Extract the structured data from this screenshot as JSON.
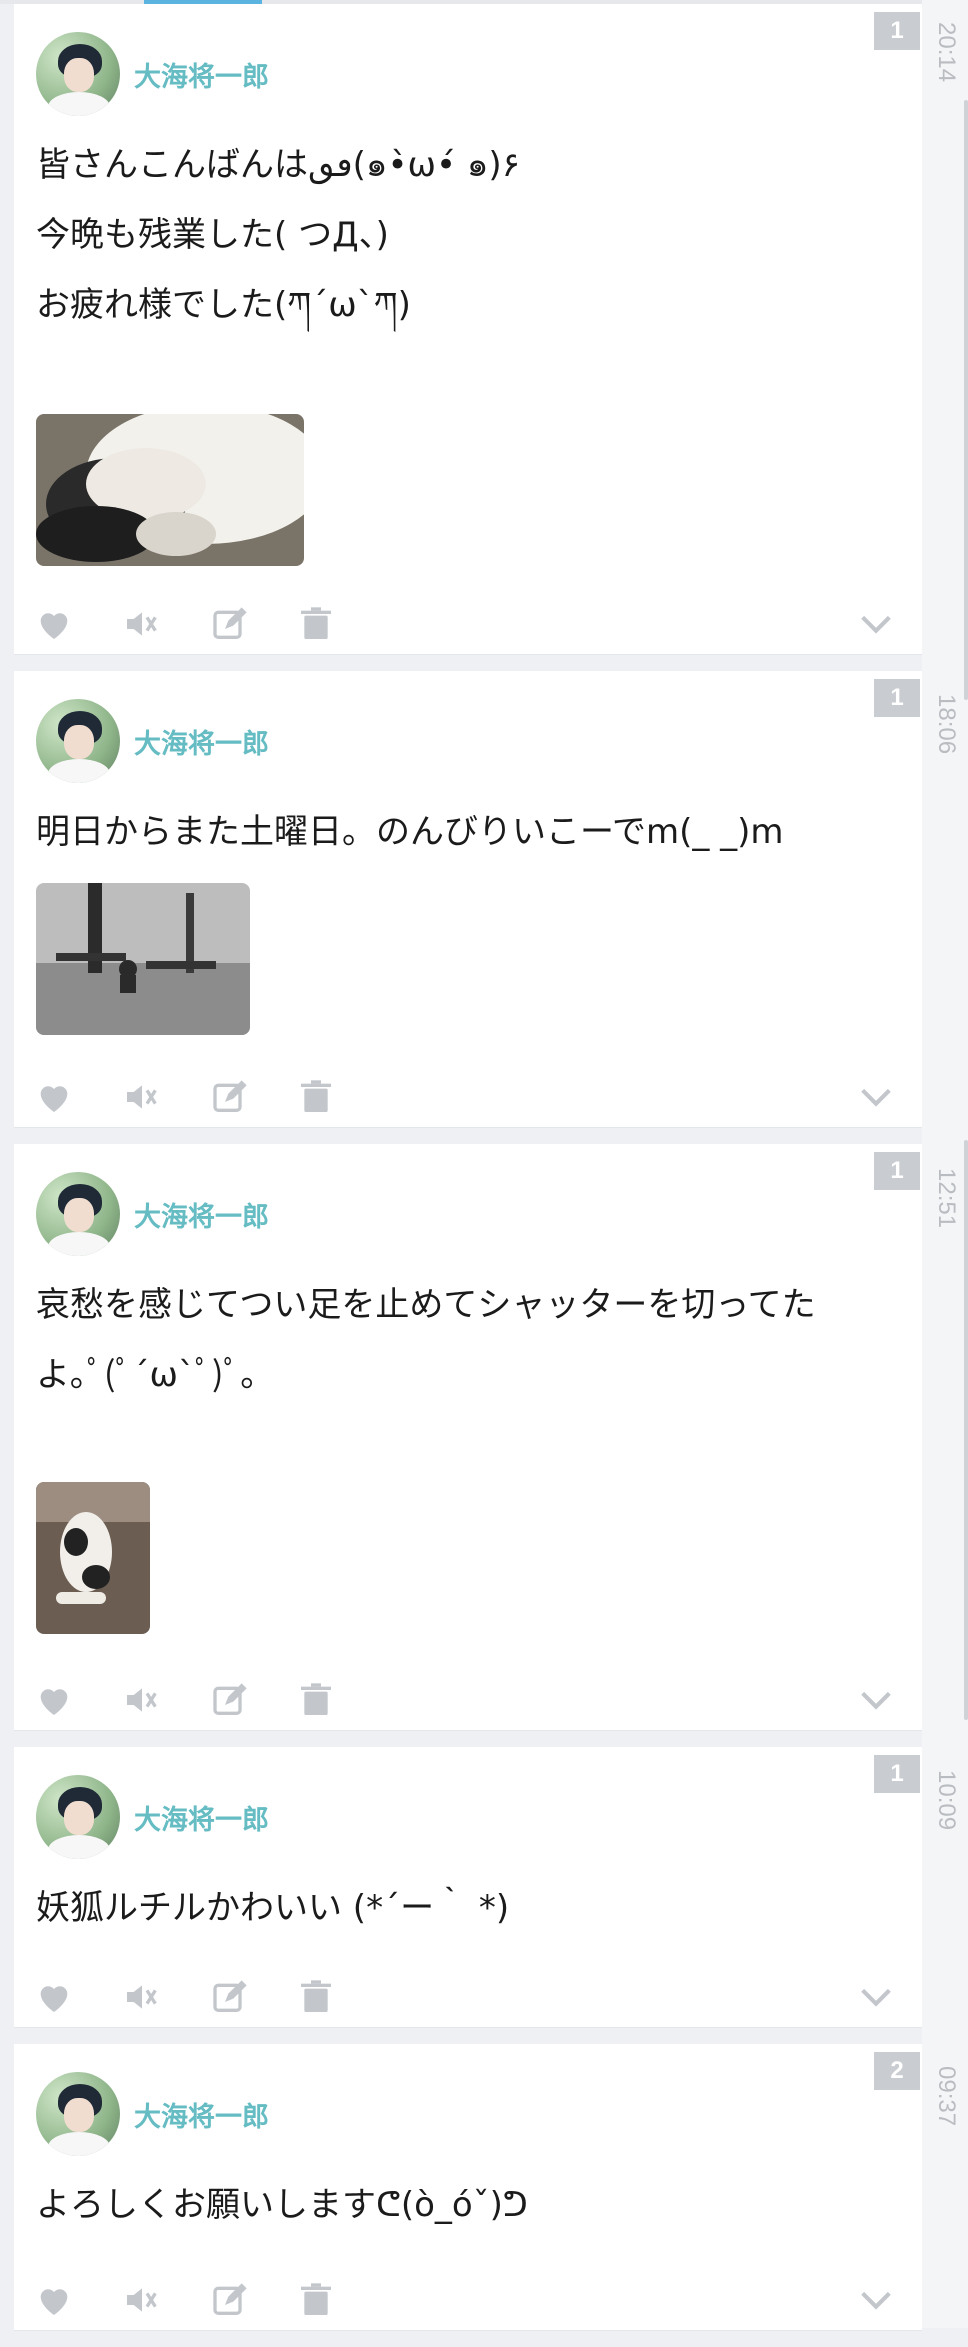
{
  "colors": {
    "accent": "#5bb3df",
    "username": "#65bcc3",
    "icon": "#c3c7cc",
    "badge": "#c9ccd0",
    "text": "#1b1b1b",
    "time": "#b9bcc0"
  },
  "icons": {
    "like": "heart-icon",
    "mute": "speaker-mute-icon",
    "edit": "edit-icon",
    "delete": "trash-icon",
    "more": "chevron-down-icon"
  },
  "timeline": {
    "times": [
      "20:14",
      "18:06",
      "12:51",
      "10:09",
      "09:37"
    ]
  },
  "posts": [
    {
      "count": "1",
      "user": "大海将一郎",
      "lines": [
        "皆さんこんばんはٯٯ(๑•̀ω•́ ๑)۶",
        "今晩も残業した( つД、)",
        "お疲れ様でした(ཀ´ω`ཀ)"
      ],
      "image": "cat-photo"
    },
    {
      "count": "1",
      "user": "大海将一郎",
      "lines": [
        "明日からまた土曜日。のんびりいこーでm(_ _)m"
      ],
      "image": "park-photo"
    },
    {
      "count": "1",
      "user": "大海将一郎",
      "lines": [
        "哀愁を感じてつい足を止めてシャッターを切ってた",
        "よ｡ﾟ(ﾟ´ω`ﾟ)ﾟ｡"
      ],
      "image": "cat-on-sofa-photo"
    },
    {
      "count": "1",
      "user": "大海将一郎",
      "lines": [
        "妖狐ルチルかわいい (*´ー｀ *)"
      ]
    },
    {
      "count": "2",
      "user": "大海将一郎",
      "lines": [
        "よろしくお願いしますᕦ(ò_óˇ)ᕤ"
      ]
    }
  ]
}
